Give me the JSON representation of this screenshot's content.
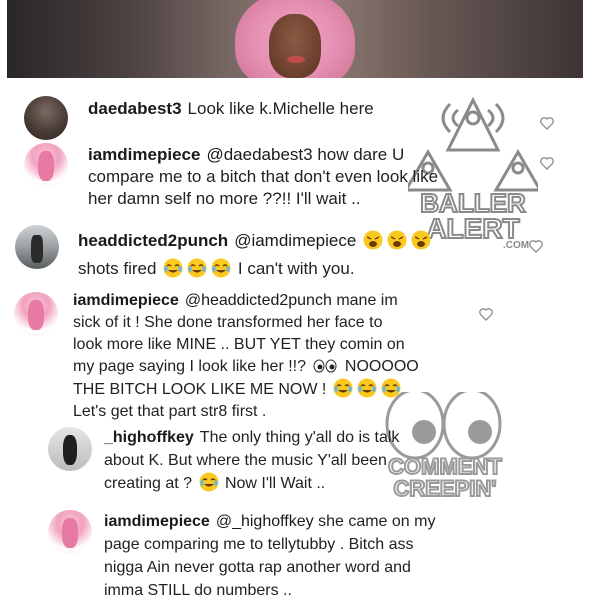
{
  "comments": [
    {
      "username": "daedabest3",
      "text": "Look like k.Michelle here",
      "lines": []
    },
    {
      "username": "iamdimepiece",
      "mention": "@daedabest3",
      "line1": "how dare U",
      "line2": "compare me to a bitch that don't even look like",
      "line3": "her damn self no more ??!! I'll wait .."
    },
    {
      "username": "headdicted2punch",
      "mention": "@iamdimepiece",
      "line2": "shots fired",
      "line2_tail": "I can't with you."
    },
    {
      "username": "iamdimepiece",
      "mention": "@headdicted2punch",
      "line1": "mane im",
      "line2": "sick of it ! She done transformed her face to",
      "line3": "look more like MINE .. BUT YET they comin on",
      "line4": "my page saying I look like her !!?",
      "line4_tail": "NOOOOO",
      "line5": "THE BITCH LOOK LIKE ME NOW !",
      "line6": "Let's get that part str8 first ."
    },
    {
      "username": "_highoffkey",
      "line1": "The only thing y'all do is talk",
      "line2": "about K. But where the music Y'all been",
      "line3": "creating at ?",
      "line3_tail": "Now I'll Wait .."
    },
    {
      "username": "iamdimepiece",
      "mention": "@_highoffkey",
      "line1": "she came on my",
      "line2": "page comparing me to tellytubby . Bitch ass",
      "line3": "nigga Ain never gotta rap another word and",
      "line4": "imma STILL do numbers .."
    }
  ],
  "watermarks": {
    "baller_line1": "BALLER",
    "baller_line2": "ALERT",
    "baller_domain": ".COM",
    "creep_line1": "COMMENT",
    "creep_line2": "CREEPIN'"
  },
  "icons": {
    "like": "heart-outline-icon",
    "laugh": "face-with-tears-of-joy-emoji",
    "weary": "weary-face-emoji",
    "eyes": "eyes-emoji"
  },
  "colors": {
    "text": "#222222",
    "heart": "#8e8e8e",
    "emoji": "#f9c920",
    "watermark": "#9a9a9a"
  }
}
